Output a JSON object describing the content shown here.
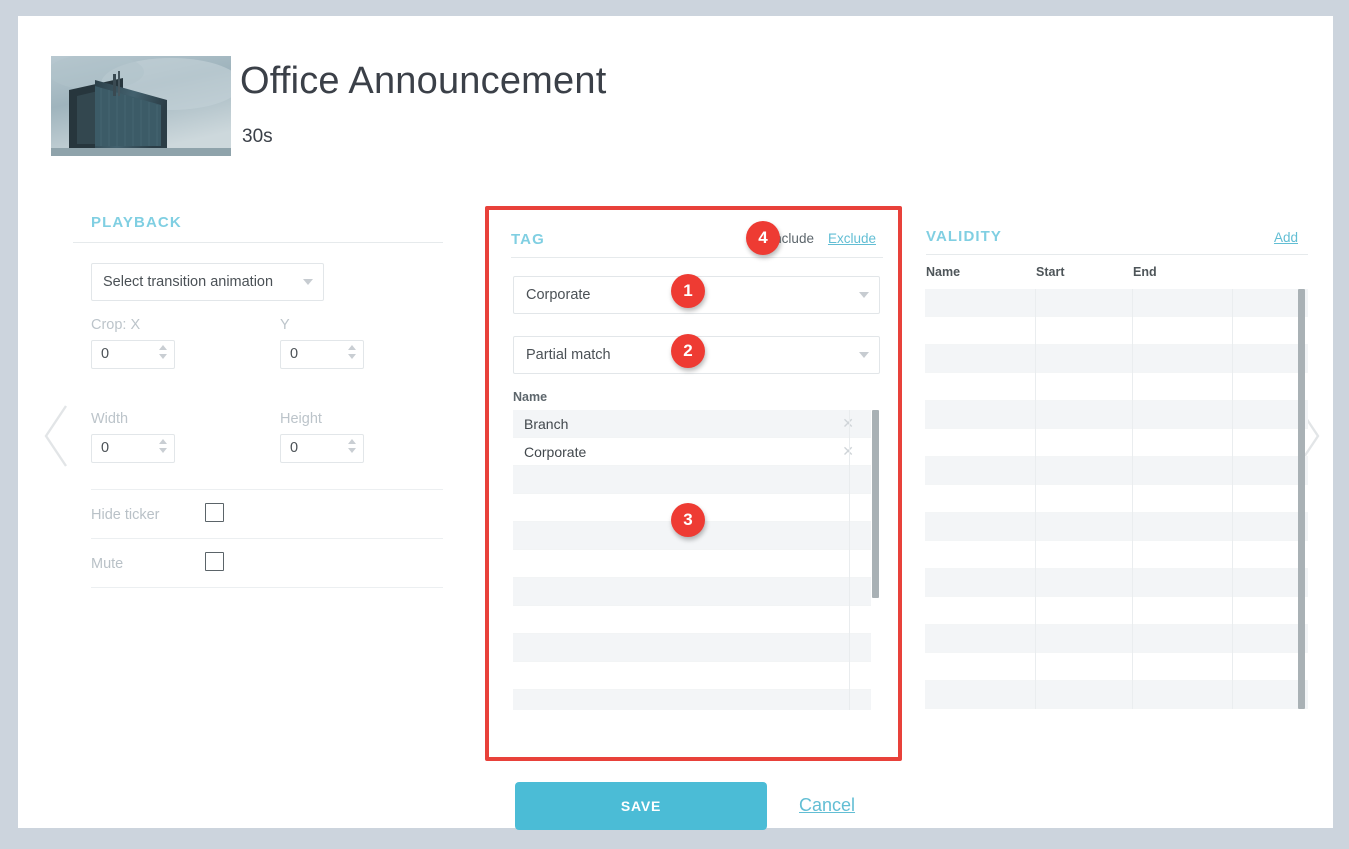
{
  "header": {
    "title": "Office Announcement",
    "duration": "30s",
    "thumbnail_alt": "office-building-photo"
  },
  "nav": {
    "prev_icon": "chevron-left-icon",
    "next_icon": "chevron-right-icon"
  },
  "playback": {
    "section_title": "PLAYBACK",
    "transition": {
      "value": "Select transition animation",
      "caret_icon": "chevron-down-icon"
    },
    "fields": [
      {
        "label": "Crop: X",
        "value": "0"
      },
      {
        "label": "Y",
        "value": "0"
      },
      {
        "label": "Width",
        "value": "0"
      },
      {
        "label": "Height",
        "value": "0"
      }
    ],
    "toggles": [
      {
        "label": "Hide ticker",
        "checked": false
      },
      {
        "label": "Mute",
        "checked": false
      }
    ]
  },
  "tag": {
    "section_title": "TAG",
    "mode_include": "Include",
    "mode_exclude": "Exclude",
    "tag_select": {
      "value": "Corporate"
    },
    "match_select": {
      "value": "Partial match"
    },
    "table": {
      "columns": [
        "Name"
      ],
      "rows": [
        {
          "name": "Branch",
          "remove_icon": "close-icon"
        },
        {
          "name": "Corporate",
          "remove_icon": "close-icon"
        },
        {
          "name": "",
          "remove_icon": ""
        },
        {
          "name": "",
          "remove_icon": ""
        },
        {
          "name": "",
          "remove_icon": ""
        },
        {
          "name": "",
          "remove_icon": ""
        },
        {
          "name": "",
          "remove_icon": ""
        },
        {
          "name": "",
          "remove_icon": ""
        },
        {
          "name": "",
          "remove_icon": ""
        },
        {
          "name": "",
          "remove_icon": ""
        },
        {
          "name": "",
          "remove_icon": ""
        }
      ]
    }
  },
  "validity": {
    "section_title": "VALIDITY",
    "add_label": "Add",
    "columns": [
      "Name",
      "Start",
      "End"
    ],
    "rows": [
      {
        "name": "",
        "start": "",
        "end": ""
      },
      {
        "name": "",
        "start": "",
        "end": ""
      },
      {
        "name": "",
        "start": "",
        "end": ""
      },
      {
        "name": "",
        "start": "",
        "end": ""
      },
      {
        "name": "",
        "start": "",
        "end": ""
      },
      {
        "name": "",
        "start": "",
        "end": ""
      },
      {
        "name": "",
        "start": "",
        "end": ""
      },
      {
        "name": "",
        "start": "",
        "end": ""
      },
      {
        "name": "",
        "start": "",
        "end": ""
      },
      {
        "name": "",
        "start": "",
        "end": ""
      },
      {
        "name": "",
        "start": "",
        "end": ""
      },
      {
        "name": "",
        "start": "",
        "end": ""
      },
      {
        "name": "",
        "start": "",
        "end": ""
      },
      {
        "name": "",
        "start": "",
        "end": ""
      },
      {
        "name": "",
        "start": "",
        "end": ""
      }
    ]
  },
  "footer": {
    "save_label": "SAVE",
    "cancel_label": "Cancel"
  },
  "annotations": {
    "badge1": "1",
    "badge2": "2",
    "badge3": "3",
    "badge4": "4"
  },
  "colors": {
    "accent_teal": "#4bbcd6",
    "section_heading": "#80cfe2",
    "highlight_red": "#e8413a",
    "badge_red": "#ee3b33",
    "page_bg": "#ccd4dd"
  }
}
